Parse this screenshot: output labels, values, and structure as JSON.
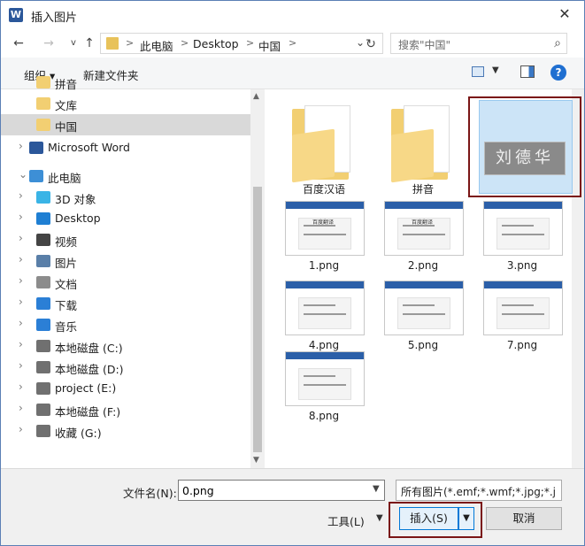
{
  "title": "插入图片",
  "app_icon_letter": "W",
  "close_glyph": "✕",
  "address": {
    "crumbs": [
      "此电脑",
      "Desktop",
      "中国"
    ],
    "separator": ">"
  },
  "search": {
    "placeholder": "搜索\"中国\""
  },
  "toolbar": {
    "organize": "组织 ▾",
    "new_folder": "新建文件夹",
    "help": "?"
  },
  "nav": [
    {
      "label": "拼音",
      "icon": "folder-icon",
      "indent": 2
    },
    {
      "label": "文库",
      "icon": "folder-icon",
      "indent": 2
    },
    {
      "label": "中国",
      "icon": "folder-icon",
      "indent": 2,
      "selected": true
    },
    {
      "label": "Microsoft Word",
      "icon": "word-icon",
      "indent": 1,
      "arrow": ">"
    },
    {
      "label": "此电脑",
      "icon": "computer-icon",
      "indent": 1,
      "arrow": "v"
    },
    {
      "label": "3D 对象",
      "icon": "3d-objects-icon",
      "indent": 2,
      "arrow": ">"
    },
    {
      "label": "Desktop",
      "icon": "desktop-icon",
      "indent": 2,
      "arrow": ">"
    },
    {
      "label": "视频",
      "icon": "video-icon",
      "indent": 2,
      "arrow": ">"
    },
    {
      "label": "图片",
      "icon": "pictures-icon",
      "indent": 2,
      "arrow": ">"
    },
    {
      "label": "文档",
      "icon": "documents-icon",
      "indent": 2,
      "arrow": ">"
    },
    {
      "label": "下载",
      "icon": "download-icon",
      "indent": 2,
      "arrow": ">"
    },
    {
      "label": "音乐",
      "icon": "music-icon",
      "indent": 2,
      "arrow": ">"
    },
    {
      "label": "本地磁盘 (C:)",
      "icon": "drive-c-icon",
      "indent": 2,
      "arrow": ">"
    },
    {
      "label": "本地磁盘 (D:)",
      "icon": "drive-icon",
      "indent": 2,
      "arrow": ">"
    },
    {
      "label": "project (E:)",
      "icon": "drive-icon",
      "indent": 2,
      "arrow": ">"
    },
    {
      "label": "本地磁盘 (F:)",
      "icon": "drive-icon",
      "indent": 2,
      "arrow": ">"
    },
    {
      "label": "收藏 (G:)",
      "icon": "drive-icon",
      "indent": 2,
      "arrow": ">"
    }
  ],
  "files": [
    {
      "name": "百度汉语",
      "kind": "folder"
    },
    {
      "name": "拼音",
      "kind": "folder"
    },
    {
      "name": "0.png",
      "kind": "image",
      "selected": true,
      "image_text": "刘德华"
    },
    {
      "name": "1.png",
      "kind": "image",
      "caption": "百度翻译"
    },
    {
      "name": "2.png",
      "kind": "image",
      "caption": "百度翻译"
    },
    {
      "name": "3.png",
      "kind": "image"
    },
    {
      "name": "4.png",
      "kind": "image"
    },
    {
      "name": "5.png",
      "kind": "image"
    },
    {
      "name": "7.png",
      "kind": "image"
    },
    {
      "name": "8.png",
      "kind": "image"
    }
  ],
  "bottom": {
    "filename_label": "文件名(N):",
    "filename_value": "0.png",
    "filter": "所有图片(*.emf;*.wmf;*.jpg;*.j",
    "tools": "工具(L)",
    "insert": "插入(S)",
    "cancel": "取消"
  }
}
